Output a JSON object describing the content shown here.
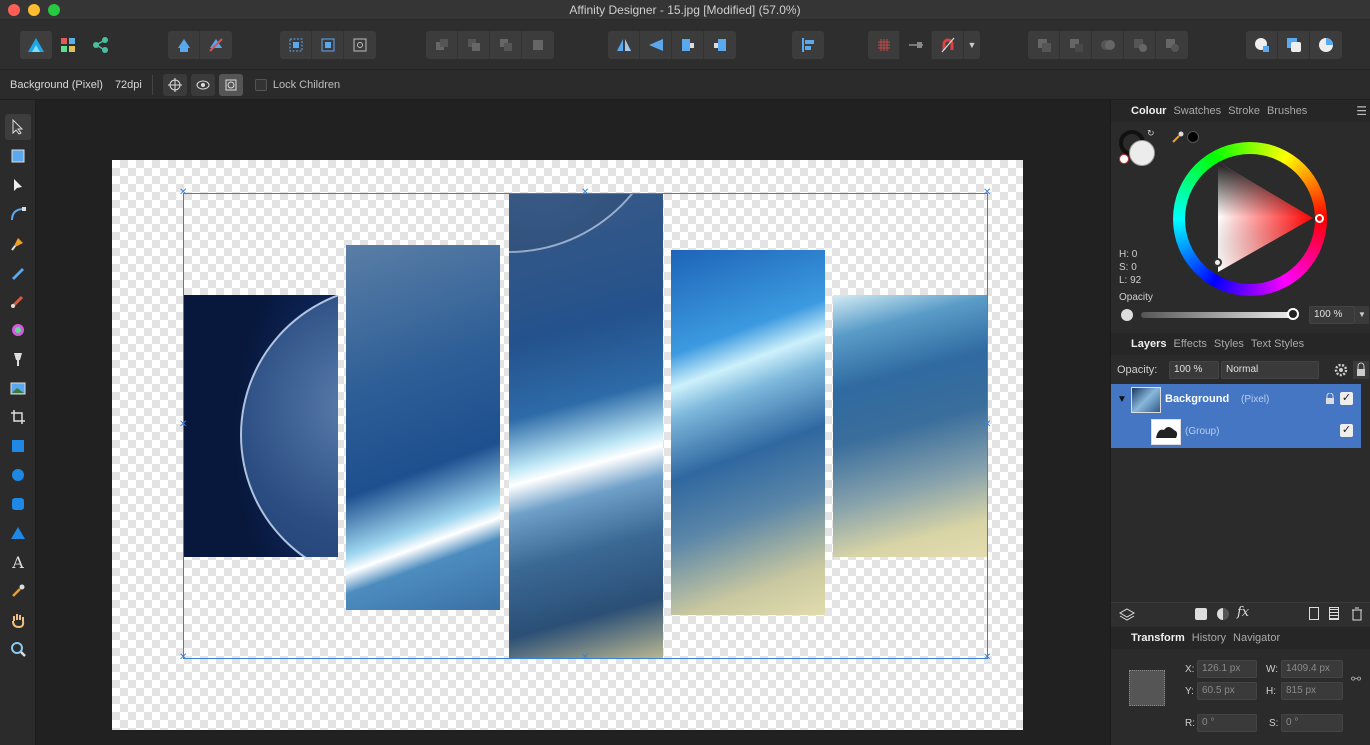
{
  "window": {
    "title": "Affinity Designer - 15.jpg [Modified] (57.0%)"
  },
  "context_bar": {
    "layer_name": "Background (Pixel)",
    "dpi": "72dpi",
    "lock_children": "Lock Children"
  },
  "colors": {
    "accent": "#4476c4",
    "selection": "#3b82d6",
    "canvas_bg": "#212121",
    "panel_bg": "#2b2b2b"
  },
  "colour_panel": {
    "tabs": [
      "Colour",
      "Swatches",
      "Stroke",
      "Brushes"
    ],
    "h": "H: 0",
    "s": "S: 0",
    "l": "L: 92",
    "opacity_label": "Opacity",
    "opacity_value": "100 %"
  },
  "layers_panel": {
    "tabs": [
      "Layers",
      "Effects",
      "Styles",
      "Text Styles"
    ],
    "opacity_label": "Opacity:",
    "opacity_value": "100 %",
    "blend_mode": "Normal",
    "layers": [
      {
        "name": "Background",
        "type": "(Pixel)"
      },
      {
        "name": "",
        "type": "(Group)"
      }
    ]
  },
  "transform_panel": {
    "tabs": [
      "Transform",
      "History",
      "Navigator"
    ],
    "x_label": "X:",
    "x": "126.1 px",
    "y_label": "Y:",
    "y": "60.5 px",
    "w_label": "W:",
    "w": "1409.4 px",
    "h_label": "H:",
    "h": "815 px",
    "r_label": "R:",
    "r": "0 °",
    "s_label": "S:",
    "s": "0 °"
  },
  "icons": {
    "toolbar": [
      "persona-designer-icon",
      "persona-pixel-icon",
      "persona-export-icon",
      "share-icon",
      "share-alt-icon",
      "select-all-icon",
      "select-bounds-icon",
      "transform-origin-icon",
      "arrange-back-icon",
      "arrange-backward-icon",
      "arrange-forward-icon",
      "arrange-front-icon",
      "flip-h-icon",
      "flip-v-icon",
      "rotate-left-icon",
      "rotate-right-icon",
      "align-icon",
      "snapping-grid-icon",
      "snapping-toggle-icon",
      "snapping-magnet-icon",
      "boolean-add-icon",
      "boolean-subtract-icon",
      "boolean-intersect-icon",
      "boolean-xor-icon",
      "boolean-divide-icon",
      "insert-behind-icon",
      "insert-inside-icon",
      "insert-top-icon"
    ],
    "tools": [
      "move-icon",
      "artboard-icon",
      "node-icon",
      "corner-icon",
      "pen-icon",
      "pencil-icon",
      "vector-brush-icon",
      "fill-icon",
      "transparency-icon",
      "place-image-icon",
      "crop-icon",
      "rectangle-icon",
      "ellipse-icon",
      "rounded-rect-icon",
      "triangle-icon",
      "text-icon",
      "color-picker-icon",
      "hand-icon",
      "zoom-icon"
    ]
  }
}
